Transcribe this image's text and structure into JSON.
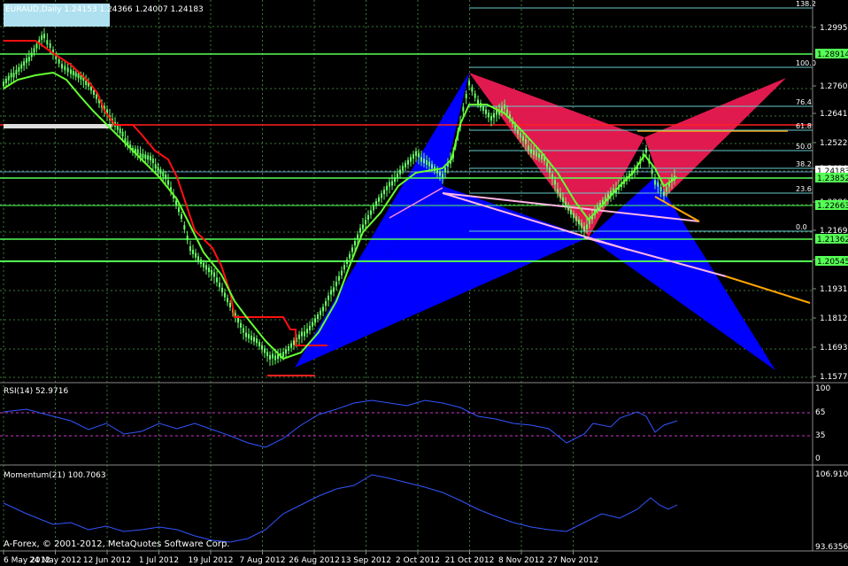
{
  "chart": {
    "symbol_title": "EURAUD,Daily  1.24153 1.24366 1.24007 1.24183",
    "copyright": "A-Forex, © 2001-2012, MetaQuotes Software Corp.",
    "colors": {
      "background": "#000000",
      "grid": "#3a7a3a",
      "candle": "#66ff66",
      "bat_blue": "#0000ff",
      "bat_red": "#e01a4f",
      "fib": "#66cccc",
      "support": "#00ff00",
      "trail": "#ff0000",
      "ma": "#66ff33",
      "trend_pink": "#ffb6e6",
      "trend_orange": "#ffa500",
      "indicator_line": "#3355ff"
    }
  },
  "price_axis": {
    "ticks": [
      "1.29950",
      "1.27600",
      "1.26410",
      "1.25225",
      "1.24045",
      "1.22860",
      "1.21690",
      "1.20500",
      "1.19310",
      "1.18120",
      "1.16930",
      "1.15775"
    ],
    "level_tags": [
      "1.28914",
      "1.24183",
      "1.23852",
      "1.22663",
      "1.21362",
      "1.20545"
    ]
  },
  "fib_levels": [
    "138.2",
    "100.0",
    "76.4",
    "61.8",
    "50.0",
    "38.2",
    "23.6",
    "0.0"
  ],
  "rsi": {
    "label": "RSI(14) 52.9716",
    "ticks": [
      "100",
      "65",
      "35",
      "0"
    ]
  },
  "momentum": {
    "label": "Momentum(21) 100.7063",
    "ticks": [
      "106.9104",
      "93.6356"
    ]
  },
  "time_axis": {
    "dates": [
      "6 May 2012",
      "24 May 2012",
      "12 Jun 2012",
      "1 Jul 2012",
      "19 Jul 2012",
      "7 Aug 2012",
      "26 Aug 2012",
      "13 Sep 2012",
      "2 Oct 2012",
      "21 Oct 2012",
      "8 Nov 2012",
      "27 Nov 2012"
    ]
  }
}
